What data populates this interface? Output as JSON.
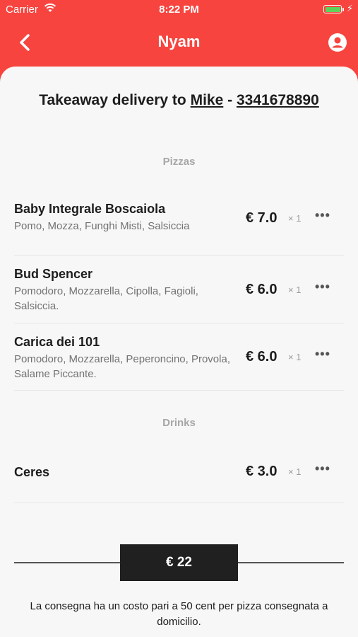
{
  "status_bar": {
    "carrier": "Carrier",
    "time": "8:22 PM"
  },
  "nav": {
    "title": "Nyam"
  },
  "header": {
    "prefix": "Takeaway delivery to",
    "customer": "Mike",
    "separator": "-",
    "phone": "3341678890"
  },
  "sections": [
    {
      "title": "Pizzas",
      "items": [
        {
          "name": "Baby Integrale Boscaiola",
          "description": "Pomo, Mozza, Funghi Misti, Salsiccia",
          "price": "€ 7.0",
          "quantity": "× 1"
        },
        {
          "name": "Bud Spencer",
          "description": "Pomodoro, Mozzarella, Cipolla, Fagioli, Salsiccia.",
          "price": "€ 6.0",
          "quantity": "× 1"
        },
        {
          "name": "Carica dei 101",
          "description": "Pomodoro, Mozzarella, Peperoncino, Provola, Salame Piccante.",
          "price": "€ 6.0",
          "quantity": "× 1"
        }
      ]
    },
    {
      "title": "Drinks",
      "items": [
        {
          "name": "Ceres",
          "description": "",
          "price": "€ 3.0",
          "quantity": "× 1"
        }
      ]
    }
  ],
  "total": "€ 22",
  "note": "La consegna ha un costo pari a 50 cent per pizza consegnata a domicilio.",
  "colors": {
    "brand": "#f7443f",
    "total_bg": "#202020",
    "battery": "#5ed35a"
  },
  "icons": [
    "wifi-icon",
    "battery-icon",
    "charging-icon",
    "back-chevron-icon",
    "profile-icon",
    "more-icon"
  ]
}
